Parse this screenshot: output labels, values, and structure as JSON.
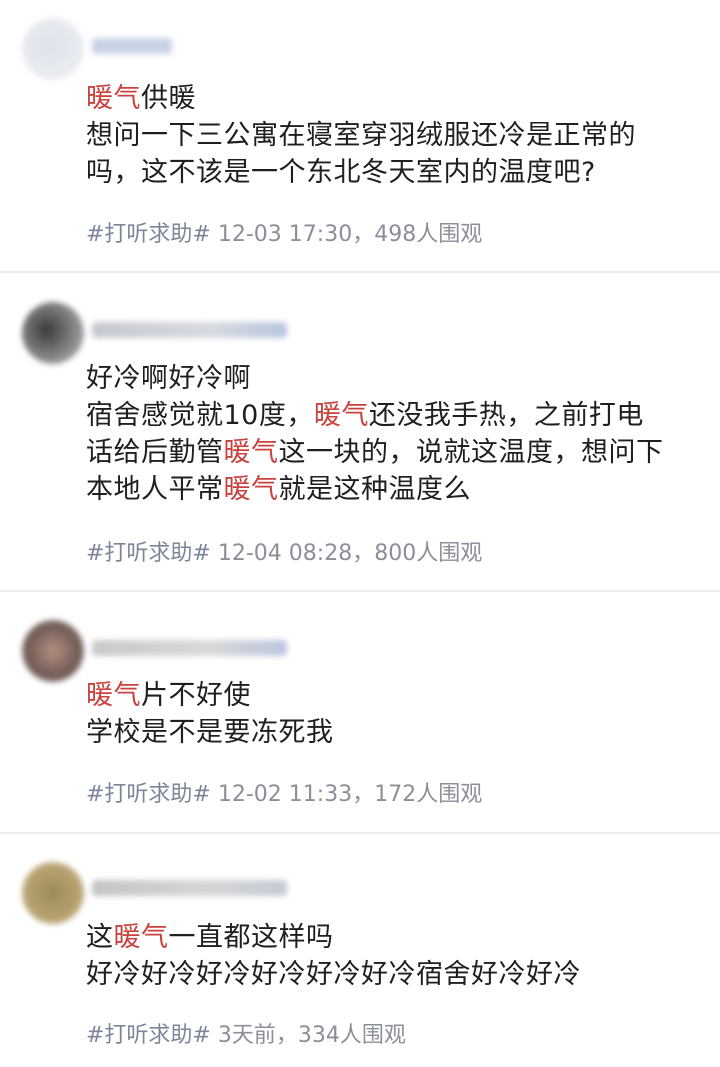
{
  "posts": [
    {
      "lines": [
        [
          {
            "t": "暖气",
            "h": true
          },
          {
            "t": "供暖",
            "h": false
          }
        ],
        [
          {
            "t": "想问一下三公寓在寝室穿羽绒服还冷是正常的",
            "h": false
          }
        ],
        [
          {
            "t": "吗，这不该是一个东北冬天室内的温度吧?",
            "h": false
          }
        ]
      ],
      "tag": "#打听求助#",
      "time": "12-03 17:30",
      "views": "498人围观"
    },
    {
      "lines": [
        [
          {
            "t": "好冷啊好冷啊",
            "h": false
          }
        ],
        [
          {
            "t": "宿舍感觉就10度，",
            "h": false
          },
          {
            "t": "暖气",
            "h": true
          },
          {
            "t": "还没我手热，之前打电",
            "h": false
          }
        ],
        [
          {
            "t": "话给后勤管",
            "h": false
          },
          {
            "t": "暖气",
            "h": true
          },
          {
            "t": "这一块的，说就这温度，想问下",
            "h": false
          }
        ],
        [
          {
            "t": "本地人平常",
            "h": false
          },
          {
            "t": "暖气",
            "h": true
          },
          {
            "t": "就是这种温度么",
            "h": false
          }
        ]
      ],
      "tag": "#打听求助#",
      "time": "12-04 08:28",
      "views": "800人围观"
    },
    {
      "lines": [
        [
          {
            "t": "暖气",
            "h": true
          },
          {
            "t": "片不好使",
            "h": false
          }
        ],
        [
          {
            "t": "学校是不是要冻死我",
            "h": false
          }
        ]
      ],
      "tag": "#打听求助#",
      "time": "12-02 11:33",
      "views": "172人围观"
    },
    {
      "lines": [
        [
          {
            "t": "这",
            "h": false
          },
          {
            "t": "暖气",
            "h": true
          },
          {
            "t": "一直都这样吗",
            "h": false
          }
        ],
        [
          {
            "t": "好冷好冷好冷好冷好冷好冷宿舍好冷好冷",
            "h": false
          }
        ]
      ],
      "tag": "#打听求助#",
      "time": "3天前",
      "views": "334人围观"
    }
  ],
  "separator": "，",
  "colors": {
    "highlight": "#c9423d",
    "meta": "#8a8f99",
    "divider": "#ececec"
  }
}
